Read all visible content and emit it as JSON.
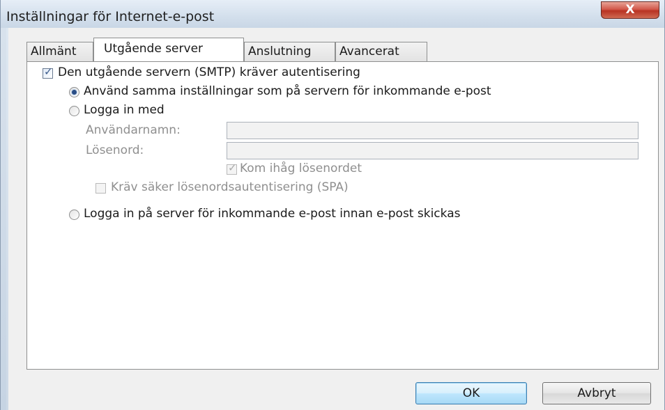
{
  "window": {
    "title": "Inställningar för Internet-e-post",
    "close_glyph": "X"
  },
  "tabs": [
    {
      "label": "Allmänt",
      "active": false
    },
    {
      "label": "Utgående server",
      "active": true
    },
    {
      "label": "Anslutning",
      "active": false
    },
    {
      "label": "Avancerat",
      "active": false
    }
  ],
  "smtp_auth": {
    "label": "Den utgående servern (SMTP) kräver autentisering",
    "checked": true
  },
  "auth_options": {
    "same_settings_label": "Använd samma inställningar som på servern för inkommande e-post",
    "same_settings_selected": true,
    "login_with_label": "Logga in med",
    "login_with_selected": false,
    "login_before_label": "Logga in på server för inkommande e-post innan e-post skickas",
    "login_before_selected": false
  },
  "credentials": {
    "username_label": "Användarnamn:",
    "username_value": "",
    "password_label": "Lösenord:",
    "password_value": "",
    "remember_label": "Kom ihåg lösenordet",
    "remember_checked": true,
    "spa_label": "Kräv säker lösenordsautentisering (SPA)",
    "spa_checked": false
  },
  "buttons": {
    "ok_label": "OK",
    "cancel_label": "Avbryt"
  }
}
